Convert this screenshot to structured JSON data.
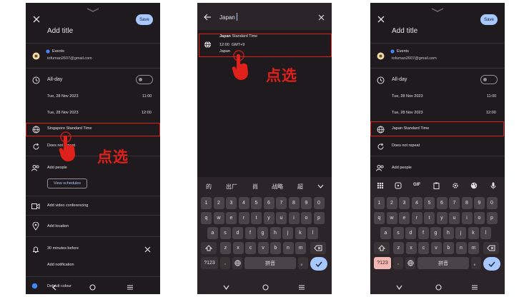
{
  "annotation": {
    "text": "点选",
    "color": "#e0201a"
  },
  "colors": {
    "bg": "#1f1a1d",
    "accent": "#a8c7fa",
    "box": "#e0201a",
    "event_dot": "#4285f4"
  },
  "screen1": {
    "title": "Add title",
    "save": "Save",
    "calendar_name": "Events",
    "account": "tofuman2607@gmail.com",
    "allday": "All-day",
    "start_date": "Tue, 28 Nov 2023",
    "start_time": "11:00",
    "end_date": "Tue, 28 Nov 2023",
    "end_time": "12:00",
    "timezone": "Singapore Standard Time",
    "repeat": "Does not repeat",
    "add_people": "Add people",
    "view_schedules": "View schedules",
    "video": "Add video conferencing",
    "location": "Add location",
    "reminder": "30 minutes before",
    "add_notification": "Add notification",
    "colour": "Default colour"
  },
  "screen2": {
    "search_value": "Japan",
    "result_title_match": "Japan",
    "result_title_rest": " Standard Time",
    "result_time": "12:00",
    "result_offset": "GMT+9",
    "result_country": "Japan",
    "candidates": [
      "的",
      "出厂",
      "尚",
      "战略",
      "超"
    ],
    "row_numbers": [
      "1",
      "2",
      "3",
      "4",
      "5",
      "6",
      "7",
      "8",
      "9",
      "0"
    ],
    "row_q": [
      "q",
      "w",
      "e",
      "r",
      "t",
      "y",
      "u",
      "i",
      "o",
      "p"
    ],
    "row_a": [
      "a",
      "s",
      "d",
      "f",
      "g",
      "h",
      "j",
      "k",
      "l"
    ],
    "row_z": [
      "z",
      "x",
      "c",
      "v",
      "b",
      "n",
      "m"
    ],
    "sym_key": "?123",
    "space_label": "拼音",
    "comma": ",",
    "period": "。"
  },
  "screen3": {
    "title": "Add title",
    "save": "Save",
    "calendar_name": "Events",
    "account": "tofuman2607@gmail.com",
    "allday": "All-day",
    "start_date": "Tue, 28 Nov 2023",
    "start_time": "11:00",
    "end_date": "Tue, 28 Nov 2023",
    "end_time": "12:00",
    "timezone": "Japan Standard Time",
    "repeat": "Does not repeat",
    "add_people": "Add people",
    "gif_label": "GIF",
    "sym_key": "?123",
    "space_label": "拼音",
    "comma": ",",
    "period": "。"
  }
}
